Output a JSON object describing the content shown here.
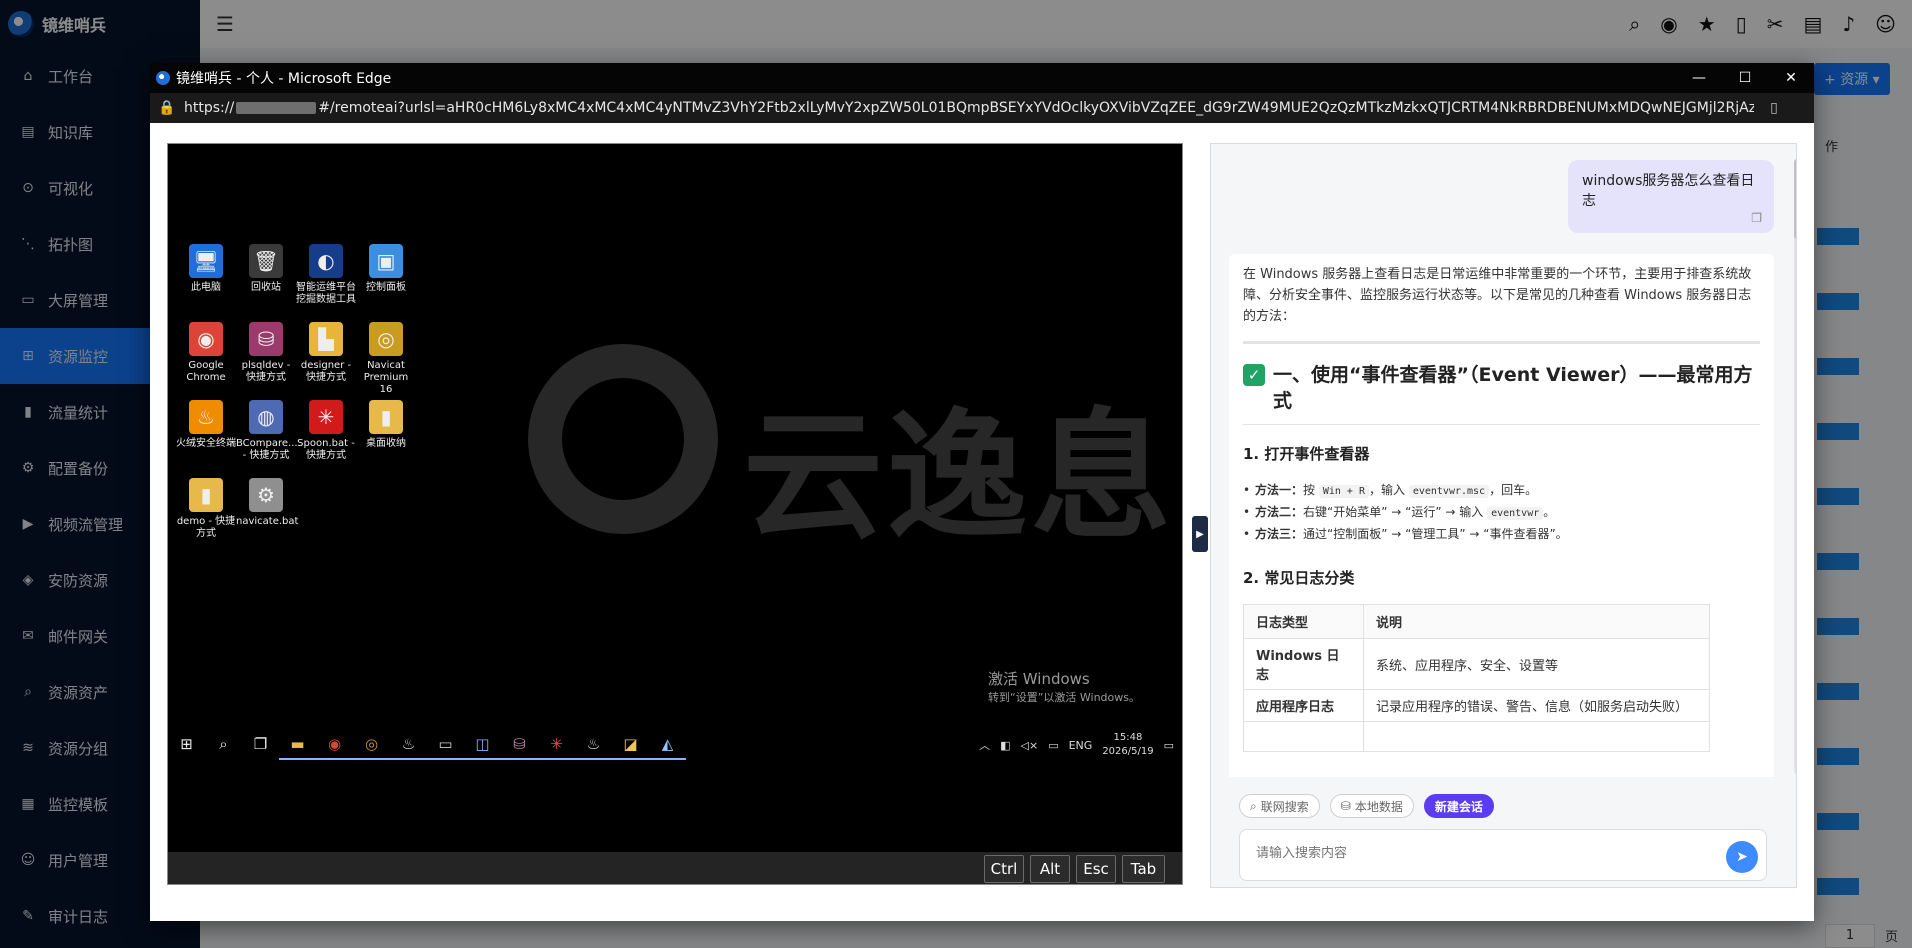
{
  "app": {
    "brand": "镜维哨兵",
    "sidebar": [
      {
        "icon": "home-icon",
        "glyph": "⌂",
        "label": "工作台"
      },
      {
        "icon": "book-icon",
        "glyph": "▤",
        "label": "知识库"
      },
      {
        "icon": "search-chart-icon",
        "glyph": "⊙",
        "label": "可视化"
      },
      {
        "icon": "topology-icon",
        "glyph": "⋱",
        "label": "拓扑图"
      },
      {
        "icon": "monitor-icon",
        "glyph": "▭",
        "label": "大屏管理"
      },
      {
        "icon": "grid-icon",
        "glyph": "⊞",
        "label": "资源监控",
        "active": true
      },
      {
        "icon": "bar-chart-icon",
        "glyph": "▮",
        "label": "流量统计"
      },
      {
        "icon": "config-icon",
        "glyph": "⚙",
        "label": "配置备份"
      },
      {
        "icon": "video-icon",
        "glyph": "▶",
        "label": "视频流管理"
      },
      {
        "icon": "shield-icon",
        "glyph": "◈",
        "label": "安防资源"
      },
      {
        "icon": "mail-icon",
        "glyph": "✉",
        "label": "邮件网关"
      },
      {
        "icon": "search-icon",
        "glyph": "⌕",
        "label": "资源资产"
      },
      {
        "icon": "layers-icon",
        "glyph": "≋",
        "label": "资源分组"
      },
      {
        "icon": "template-icon",
        "glyph": "▦",
        "label": "监控模板"
      },
      {
        "icon": "user-icon",
        "glyph": "☺",
        "label": "用户管理"
      },
      {
        "icon": "audit-icon",
        "glyph": "✎",
        "label": "审计日志"
      }
    ],
    "add_resource_label": "资源",
    "op_header": "作",
    "pagination": {
      "page": "1",
      "suffix": "页"
    }
  },
  "edge": {
    "title": "镜维哨兵 - 个人 - Microsoft Edge",
    "url_prefix": "https://",
    "url_rest": "#/remoteai?urlsl=aHR0cHM6Ly8xMC4xMC4xMC4yNTMvZ3VhY2Ftb2xlLyMvY2xpZW50L01BQmpBSEYxYVdOclkyOXVibVZqZEE_dG9rZW49MUE2QzQzMTkzMzkxQTJCRTM4NkRBRDBENUMxMDQwNEJGMjl2RjAzNDFFNEM5MzgyOEJBQj..."
  },
  "remote": {
    "watermark": "云逸息",
    "desktop_icons": [
      {
        "name": "this-pc-icon",
        "glyph": "🖥",
        "bg": "#1e6fd9",
        "label": "此电脑"
      },
      {
        "name": "recycle-bin-icon",
        "glyph": "🗑",
        "bg": "#3a3a3a",
        "label": "回收站"
      },
      {
        "name": "smart-tool-icon",
        "glyph": "◐",
        "bg": "#163c8c",
        "label": "智能运维平台 挖掘数据工具"
      },
      {
        "name": "control-panel-icon",
        "glyph": "▣",
        "bg": "#3b8ee0",
        "label": "控制面板"
      },
      {
        "name": "chrome-icon",
        "glyph": "◉",
        "bg": "#db4437",
        "label": "Google Chrome"
      },
      {
        "name": "plsqldev-icon",
        "glyph": "⛁",
        "bg": "#9b3b6b",
        "label": "plsqldev - 快捷方式"
      },
      {
        "name": "designer-icon",
        "glyph": "▙",
        "bg": "#e8b53a",
        "label": "designer - 快捷方式"
      },
      {
        "name": "navicat-icon",
        "glyph": "◎",
        "bg": "#c99b20",
        "label": "Navicat Premium 16"
      },
      {
        "name": "huorong-icon",
        "glyph": "♨",
        "bg": "#f08c00",
        "label": "火绒安全终端"
      },
      {
        "name": "bcompare-icon",
        "glyph": "◍",
        "bg": "#4e6ab3",
        "label": "BCompare... - 快捷方式"
      },
      {
        "name": "spoon-icon",
        "glyph": "✳",
        "bg": "#d11b1b",
        "label": "Spoon.bat - 快捷方式"
      },
      {
        "name": "folder-icon",
        "glyph": "▮",
        "bg": "#e6b94a",
        "label": "桌面收纳"
      },
      {
        "name": "demo-folder-icon",
        "glyph": "▮",
        "bg": "#e6b94a",
        "label": "demo - 快捷方式"
      },
      {
        "name": "bat-file-icon",
        "glyph": "⚙",
        "bg": "#8f8f8f",
        "label": "navicate.bat"
      }
    ],
    "activate_line1": "激活 Windows",
    "activate_line2": "转到“设置”以激活 Windows。",
    "taskbar": [
      {
        "name": "start-icon",
        "glyph": "⊞"
      },
      {
        "name": "taskbar-search-icon",
        "glyph": "⌕"
      },
      {
        "name": "task-view-icon",
        "glyph": "❐"
      },
      {
        "name": "explorer-icon",
        "glyph": "▬",
        "color": "#e6b94a"
      },
      {
        "name": "taskbar-chrome-icon",
        "glyph": "◉",
        "color": "#db4437"
      },
      {
        "name": "taskbar-navicat-icon",
        "glyph": "◎",
        "color": "#c99b20"
      },
      {
        "name": "java-icon",
        "glyph": "♨",
        "color": "#e0e0e0"
      },
      {
        "name": "terminal-icon",
        "glyph": "▭",
        "color": "#cfcfcf"
      },
      {
        "name": "magnifier-app-icon",
        "glyph": "◫",
        "color": "#7fb3ff"
      },
      {
        "name": "plsql-taskbar-icon",
        "glyph": "⛁",
        "color": "#c98bb0"
      },
      {
        "name": "spoon-taskbar-icon",
        "glyph": "✳",
        "color": "#ff4444"
      },
      {
        "name": "java2-icon",
        "glyph": "♨",
        "color": "#e0e0e0"
      },
      {
        "name": "notes-icon",
        "glyph": "◪",
        "color": "#f1c84b"
      },
      {
        "name": "network-app-icon",
        "glyph": "◭",
        "color": "#8fc7ff"
      }
    ],
    "tray": {
      "lang": "ENG",
      "time": "15:48",
      "date": "2026/5/19"
    },
    "keys": [
      "Ctrl",
      "Alt",
      "Esc",
      "Tab"
    ]
  },
  "chat": {
    "user_question": "windows服务器怎么查看日志",
    "intro": "在 Windows 服务器上查看日志是日常运维中非常重要的一个环节，主要用于排查系统故障、分析安全事件、监控服务运行状态等。以下是常见的几种查看 Windows 服务器日志的方法：",
    "h1": "一、使用“事件查看器”（Event Viewer）——最常用方式",
    "h3_open": "1. 打开事件查看器",
    "methods": [
      {
        "label": "方法一：",
        "pre": "按 ",
        "code1": "Win + R",
        "mid": "，输入 ",
        "code2": "eventvwr.msc",
        "post": "，回车。"
      },
      {
        "label": "方法二：",
        "pre": "右键“开始菜单” → “运行” → 输入 ",
        "code1": "eventvwr",
        "mid": "。",
        "code2": "",
        "post": ""
      },
      {
        "label": "方法三：",
        "pre": "通过“控制面板” → “管理工具” → “事件查看器”。",
        "code1": "",
        "mid": "",
        "code2": "",
        "post": ""
      }
    ],
    "h3_types": "2. 常见日志分类",
    "table_headers": [
      "日志类型",
      "说明"
    ],
    "table_rows": [
      [
        "Windows 日志",
        "系统、应用程序、安全、设置等"
      ],
      [
        "应用程序日志",
        "记录应用程序的错误、警告、信息（如服务启动失败）"
      ]
    ],
    "chips": [
      "联网搜索",
      "本地数据",
      "新建会话"
    ],
    "input_placeholder": "请输入搜索内容"
  }
}
